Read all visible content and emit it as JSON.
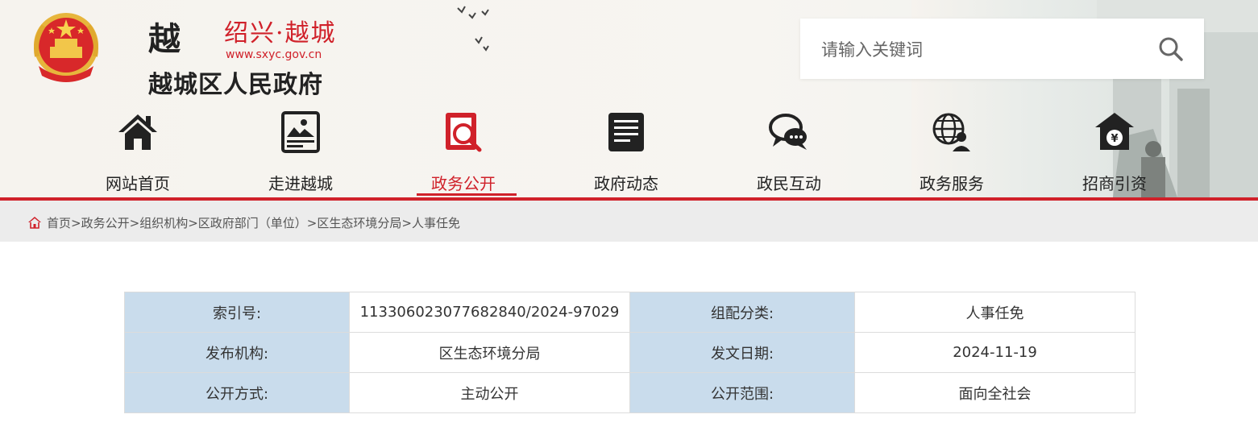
{
  "header": {
    "logo_mark": "越",
    "city_name": "绍兴·越城",
    "site_url": "www.sxyc.gov.cn",
    "gov_name": "越城区人民政府"
  },
  "search": {
    "placeholder": "请输入关键词",
    "icon": "search-icon"
  },
  "nav": {
    "items": [
      {
        "label": "网站首页",
        "icon": "home-icon"
      },
      {
        "label": "走进越城",
        "icon": "picture-icon"
      },
      {
        "label": "政务公开",
        "icon": "document-search-icon",
        "active": true
      },
      {
        "label": "政府动态",
        "icon": "news-icon"
      },
      {
        "label": "政民互动",
        "icon": "chat-icon"
      },
      {
        "label": "政务服务",
        "icon": "globe-user-icon"
      },
      {
        "label": "招商引资",
        "icon": "yuan-house-icon"
      }
    ]
  },
  "breadcrumb": {
    "items": [
      "首页",
      "政务公开",
      "组织机构",
      "区政府部门（单位）",
      "区生态环境分局",
      "人事任免"
    ],
    "separator": ">"
  },
  "info": {
    "rows": [
      {
        "k1": "索引号:",
        "v1": "113306023077682840/2024-97029",
        "k2": "组配分类:",
        "v2": "人事任免"
      },
      {
        "k1": "发布机构:",
        "v1": "区生态环境分局",
        "k2": "发文日期:",
        "v2": "2024-11-19"
      },
      {
        "k1": "公开方式:",
        "v1": "主动公开",
        "k2": "公开范围:",
        "v2": "面向全社会"
      }
    ]
  },
  "colors": {
    "accent": "#d0212a",
    "label_cell": "#c9dcec",
    "crumb_bar": "#ececec"
  }
}
